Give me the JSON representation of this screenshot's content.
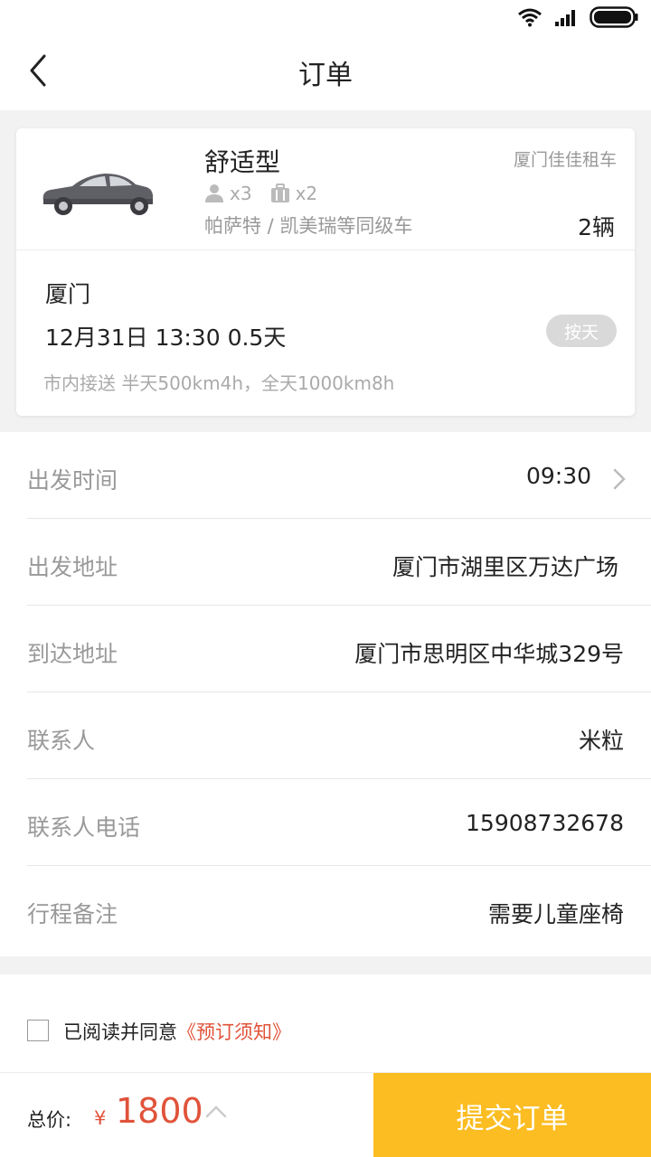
{
  "header": {
    "title": "订单"
  },
  "car": {
    "type": "舒适型",
    "company": "厦门佳佳租车",
    "passengers": "x3",
    "luggage": "x2",
    "models": "帕萨特 / 凯美瑞等同级车",
    "count": "2辆"
  },
  "trip": {
    "city": "厦门",
    "datetime": "12月31日 13:30   0.5天",
    "badge": "按天",
    "note": "市内接送 半天500km4h，全天1000km8h"
  },
  "form": {
    "rows": [
      {
        "label": "出发时间",
        "value": "09:30"
      },
      {
        "label": "出发地址",
        "value": "厦门市湖里区万达广场"
      },
      {
        "label": "到达地址",
        "value": "厦门市思明区中华城329号"
      },
      {
        "label": "联系人",
        "value": "米粒"
      },
      {
        "label": "联系人电话",
        "value": "15908732678"
      },
      {
        "label": "行程备注",
        "value": "需要儿童座椅"
      }
    ]
  },
  "agreement": {
    "text": "已阅读并同意",
    "link": "《预订须知》"
  },
  "footer": {
    "total_label": "总价:",
    "currency": "¥",
    "price": "1800",
    "submit_label": "提交订单"
  },
  "colors": {
    "accent": "#fbbd22",
    "price": "#e0533a"
  }
}
